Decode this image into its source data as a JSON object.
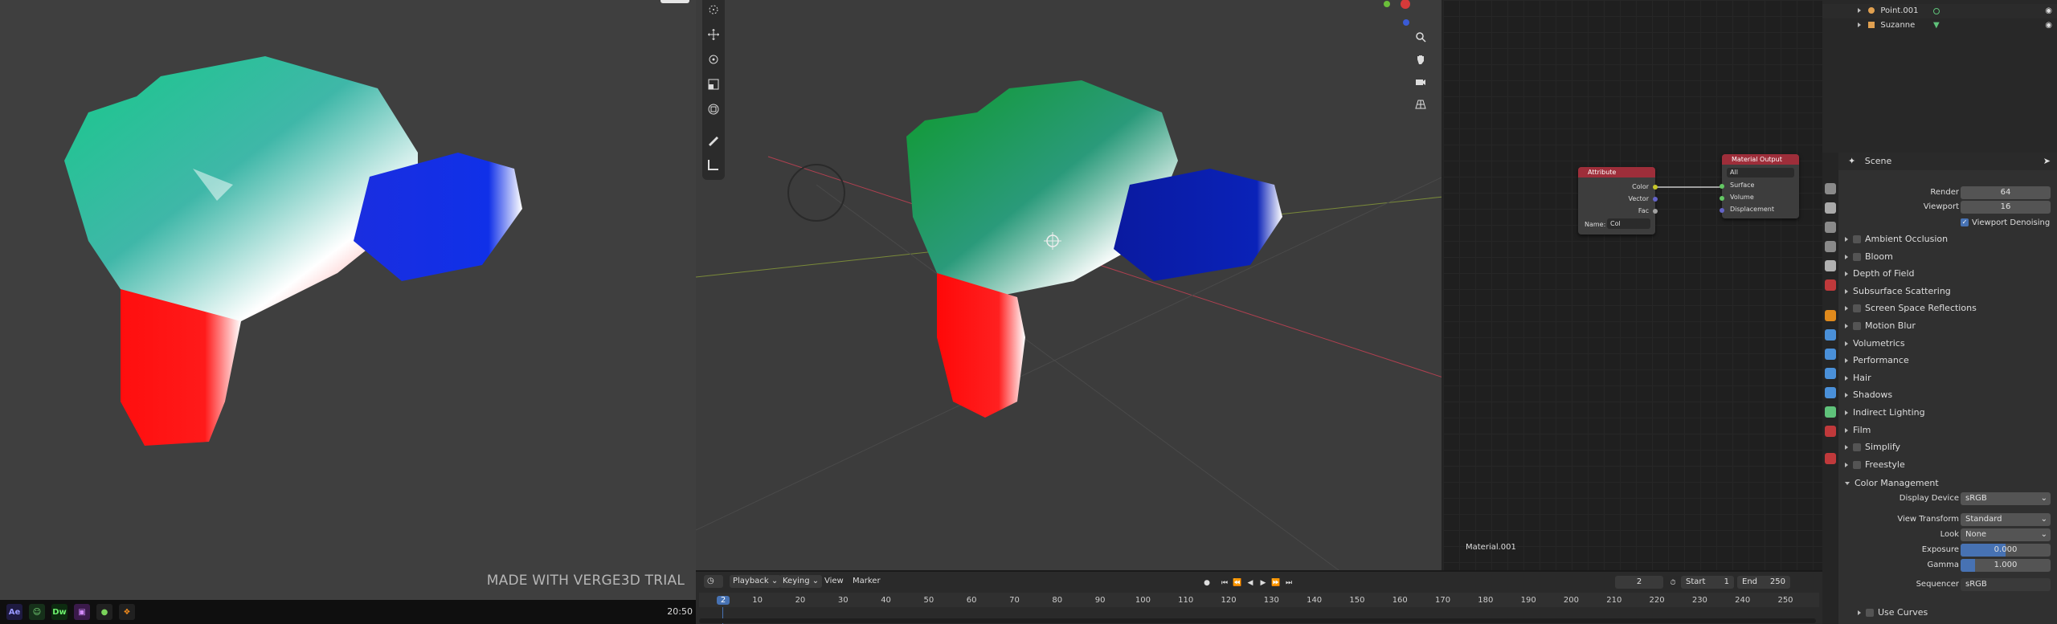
{
  "left_viewer": {
    "watermark": "MADE WITH VERGE3D TRIAL"
  },
  "taskbar": {
    "clock": "20:50",
    "apps": [
      {
        "label": "Ae",
        "bg": "#1e1a40",
        "fg": "#9999ff"
      },
      {
        "label": "☺",
        "bg": "#16301a",
        "fg": "#7ee07e"
      },
      {
        "label": "Dw",
        "bg": "#0d2b10",
        "fg": "#6df06d"
      },
      {
        "label": "▣",
        "bg": "#3a1a4a",
        "fg": "#d38bff"
      },
      {
        "label": "●",
        "bg": "#202020",
        "fg": "#7ad35b"
      },
      {
        "label": "❖",
        "bg": "#202020",
        "fg": "#f08a1c"
      }
    ]
  },
  "node_editor": {
    "attribute_node": {
      "title": "Attribute",
      "outputs": [
        "Color",
        "Vector",
        "Fac"
      ],
      "name_label": "Name:",
      "name_value": "Col"
    },
    "output_node": {
      "title": "Material Output",
      "target": "All",
      "inputs": [
        "Surface",
        "Volume",
        "Displacement"
      ]
    },
    "material_label": "Material.001"
  },
  "outliner": {
    "rows": [
      "Point.001",
      "Suzanne"
    ]
  },
  "properties": {
    "header": "Scene",
    "sampling": {
      "render_label": "Render",
      "render_value": "64",
      "viewport_label": "Viewport",
      "viewport_value": "16",
      "denoise_label": "Viewport Denoising"
    },
    "panels": [
      {
        "label": "Ambient Occlusion",
        "checkbox": true
      },
      {
        "label": "Bloom",
        "checkbox": true
      },
      {
        "label": "Depth of Field",
        "checkbox": false
      },
      {
        "label": "Subsurface Scattering",
        "checkbox": false
      },
      {
        "label": "Screen Space Reflections",
        "checkbox": true
      },
      {
        "label": "Motion Blur",
        "checkbox": true
      },
      {
        "label": "Volumetrics",
        "checkbox": false
      },
      {
        "label": "Performance",
        "checkbox": false
      },
      {
        "label": "Hair",
        "checkbox": false
      },
      {
        "label": "Shadows",
        "checkbox": false
      },
      {
        "label": "Indirect Lighting",
        "checkbox": false
      },
      {
        "label": "Film",
        "checkbox": false
      },
      {
        "label": "Simplify",
        "checkbox": true
      },
      {
        "label": "Freestyle",
        "checkbox": true
      }
    ],
    "color_management": {
      "label": "Color Management",
      "display_device_label": "Display Device",
      "display_device_value": "sRGB",
      "view_transform_label": "View Transform",
      "view_transform_value": "Standard",
      "look_label": "Look",
      "look_value": "None",
      "exposure_label": "Exposure",
      "exposure_value": "0.000",
      "gamma_label": "Gamma",
      "gamma_value": "1.000",
      "sequencer_label": "Sequencer",
      "sequencer_value": "sRGB",
      "use_curves_label": "Use Curves"
    }
  },
  "timeline": {
    "menus": [
      "Playback",
      "Keying",
      "View",
      "Marker"
    ],
    "current_frame": "2",
    "start_label": "Start",
    "start_value": "1",
    "end_label": "End",
    "end_value": "250",
    "ticks": [
      "2",
      "10",
      "20",
      "30",
      "40",
      "50",
      "60",
      "70",
      "80",
      "90",
      "100",
      "110",
      "120",
      "130",
      "140",
      "150",
      "160",
      "170",
      "180",
      "190",
      "200",
      "210",
      "220",
      "230",
      "240",
      "250"
    ]
  }
}
